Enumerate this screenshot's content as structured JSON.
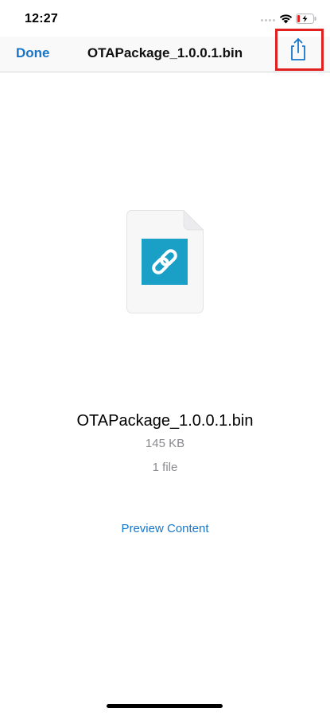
{
  "status_bar": {
    "time": "12:27"
  },
  "nav": {
    "done_label": "Done",
    "title": "OTAPackage_1.0.0.1.bin"
  },
  "file": {
    "name": "OTAPackage_1.0.0.1.bin",
    "size": "145 KB",
    "count": "1 file",
    "icon": "chain-link-icon"
  },
  "actions": {
    "preview_label": "Preview Content",
    "share_icon": "share-icon"
  },
  "colors": {
    "accent": "#1776c9",
    "highlight_box": "#e0211f",
    "file_icon_tile": "#1a9fc6"
  }
}
